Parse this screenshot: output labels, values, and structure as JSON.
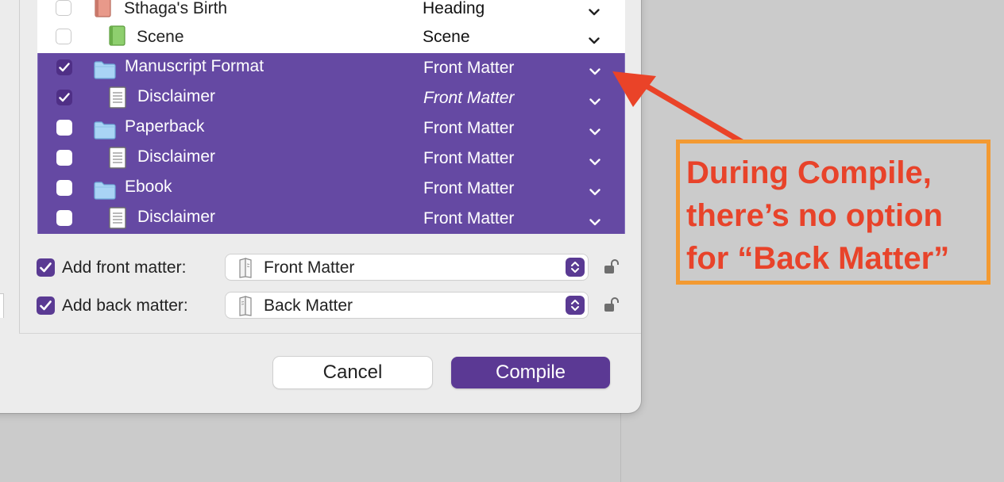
{
  "binder_rows": [
    {
      "title": "Sthaga's Birth",
      "section": "Heading",
      "checked": false,
      "selected": false,
      "icon": "book-icon",
      "indent": 0,
      "italic": false
    },
    {
      "title": "Scene",
      "section": "Scene",
      "checked": false,
      "selected": false,
      "icon": "green-book-icon",
      "indent": 1,
      "italic": false
    },
    {
      "title": "Manuscript Format",
      "section": "Front Matter",
      "checked": true,
      "selected": true,
      "icon": "folder-icon",
      "indent": 0,
      "italic": false
    },
    {
      "title": "Disclaimer",
      "section": "Front Matter",
      "checked": true,
      "selected": true,
      "icon": "document-icon",
      "indent": 1,
      "italic": true
    },
    {
      "title": "Paperback",
      "section": "Front Matter",
      "checked": false,
      "selected": true,
      "icon": "folder-icon",
      "indent": 0,
      "italic": false
    },
    {
      "title": "Disclaimer",
      "section": "Front Matter",
      "checked": false,
      "selected": true,
      "icon": "document-icon",
      "indent": 1,
      "italic": false
    },
    {
      "title": "Ebook",
      "section": "Front Matter",
      "checked": false,
      "selected": true,
      "icon": "folder-icon",
      "indent": 0,
      "italic": false
    },
    {
      "title": "Disclaimer",
      "section": "Front Matter",
      "checked": false,
      "selected": true,
      "icon": "document-icon",
      "indent": 1,
      "italic": false
    }
  ],
  "front_matter": {
    "label": "Add front matter:",
    "value": "Front Matter",
    "checked": true
  },
  "back_matter": {
    "label": "Add back matter:",
    "value": "Back Matter",
    "checked": true
  },
  "buttons": {
    "cancel": "Cancel",
    "compile": "Compile"
  },
  "annotation": {
    "text": "During Compile,\nthere’s no option\nfor “Back Matter”",
    "text_color": "#e8432a",
    "border_color": "#f39a32",
    "arrow_color": "#ea4328"
  },
  "colors": {
    "selection": "#6549a3",
    "accent": "#5b3994"
  }
}
